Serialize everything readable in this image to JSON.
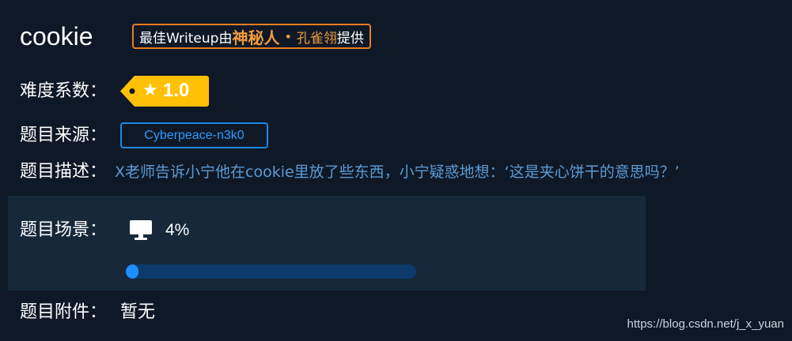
{
  "challenge": {
    "title": "cookie",
    "writeup": {
      "prefix": "最佳Writeup由",
      "author_title": "神秘人",
      "separator": "•",
      "author_name": "孔雀翎",
      "suffix": "提供"
    },
    "difficulty": {
      "label": "难度系数：",
      "star_icon": "star-icon",
      "value": "1.0",
      "color": "#ffc107"
    },
    "source": {
      "label": "题目来源：",
      "value": "Cyberpeace-n3k0"
    },
    "description": {
      "label": "题目描述：",
      "text": "X老师告诉小宁他在cookie里放了些东西，小宁疑惑地想：‘这是夹心饼干的意思吗？’"
    },
    "scene": {
      "label": "题目场景：",
      "icon": "monitor-icon",
      "percent_text": "4%",
      "progress": 0.04
    },
    "attachment": {
      "label": "题目附件：",
      "value": "暂无"
    }
  },
  "watermark": "https://blog.csdn.net/j_x_yuan",
  "colors": {
    "background": "#0f1826",
    "panel": "#17283b",
    "accent_orange": "#e67e22",
    "accent_blue": "#1e88e5",
    "desc_blue": "#5b9bd5",
    "progress_track": "#0d3a6b",
    "progress_fill": "#1e8fff"
  }
}
